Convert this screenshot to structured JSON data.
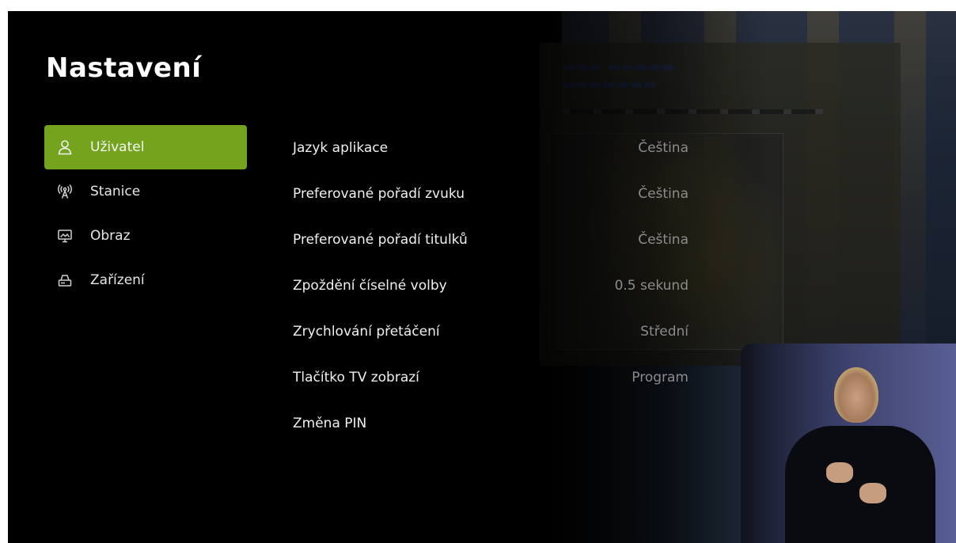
{
  "page": {
    "title": "Nastavení"
  },
  "sidebar": {
    "items": [
      {
        "label": "Uživatel",
        "icon": "user-icon",
        "active": true
      },
      {
        "label": "Stanice",
        "icon": "antenna-icon",
        "active": false
      },
      {
        "label": "Obraz",
        "icon": "monitor-icon",
        "active": false
      },
      {
        "label": "Zařízení",
        "icon": "device-icon",
        "active": false
      }
    ]
  },
  "settings": {
    "rows": [
      {
        "label": "Jazyk aplikace",
        "value": "Čeština"
      },
      {
        "label": "Preferované pořadí zvuku",
        "value": "Čeština"
      },
      {
        "label": "Preferované pořadí titulků",
        "value": "Čeština"
      },
      {
        "label": "Zpoždění číselné volby",
        "value": "0.5 sekund"
      },
      {
        "label": "Zrychlování přetáčení",
        "value": "Střední"
      },
      {
        "label": "Tlačítko TV zobrazí",
        "value": "Program"
      },
      {
        "label": "Změna PIN",
        "value": ""
      }
    ]
  },
  "colors": {
    "background": "#000000",
    "accent": "#74a41d",
    "label_text": "#f0f0f0",
    "value_text": "#8c8c8c"
  }
}
